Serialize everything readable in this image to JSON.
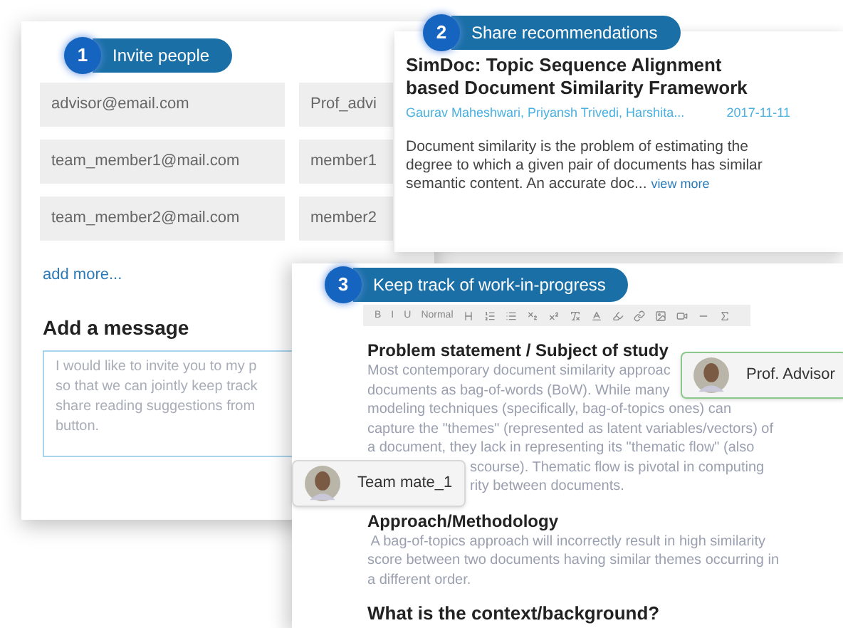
{
  "invite": {
    "step": {
      "number": "1",
      "label": "Invite people"
    },
    "rows": [
      {
        "email": "advisor@email.com",
        "name": "Prof_advi"
      },
      {
        "email": "team_member1@mail.com",
        "name": "member1"
      },
      {
        "email": "team_member2@mail.com",
        "name": "member2"
      }
    ],
    "add_more": "add more...",
    "message_title": "Add a message",
    "message_placeholder": "I would like to invite you to my p\nso that we can jointly keep track\nshare reading suggestions from\nbutton."
  },
  "recommendation": {
    "step": {
      "number": "2",
      "label": "Share recommendations"
    },
    "title": "SimDoc: Topic Sequence Alignment based Document Similarity Framework",
    "authors": "Gaurav Maheshwari, Priyansh Trivedi, Harshita...",
    "date": "2017-11-11",
    "abstract": "Document similarity is the problem of estimating the degree to which a given pair of documents has similar semantic content. An accurate doc...",
    "view_more": "view more"
  },
  "editor": {
    "step": {
      "number": "3",
      "label": "Keep track of work-in-progress"
    },
    "toolbar": [
      {
        "kind": "text",
        "label": "B"
      },
      {
        "kind": "text",
        "label": "I"
      },
      {
        "kind": "text",
        "label": "U"
      },
      {
        "kind": "text",
        "label": "Normal"
      },
      {
        "kind": "icon"
      },
      {
        "kind": "icon"
      },
      {
        "kind": "icon"
      },
      {
        "kind": "icon"
      },
      {
        "kind": "icon"
      },
      {
        "kind": "icon"
      },
      {
        "kind": "icon"
      },
      {
        "kind": "icon"
      },
      {
        "kind": "icon"
      },
      {
        "kind": "icon"
      },
      {
        "kind": "icon"
      },
      {
        "kind": "icon"
      },
      {
        "kind": "icon"
      }
    ],
    "sections": [
      {
        "heading": "Problem statement / Subject of study",
        "lines": [
          {
            "text": "Most contemporary document similarity approac",
            "kind": "line"
          },
          {
            "text": "documents as bag-of-words (BoW). While many",
            "kind": "line"
          },
          {
            "text": "modeling techniques (specifically, bag-of-topics ones) can",
            "kind": "line"
          },
          {
            "text": "capture the \"themes\" (represented as latent variables/vectors) of",
            "kind": "line"
          },
          {
            "text": "a document, they lack in representing its \"thematic flow\" (also",
            "kind": "line"
          },
          {
            "text": "scourse). Thematic flow is pivotal in computing",
            "kind": "beside_card"
          },
          {
            "text": "rity between documents.",
            "kind": "beside_card"
          }
        ]
      },
      {
        "heading": "Approach/Methodology",
        "lines": [
          {
            "text": " A bag-of-topics approach will incorrectly result in high similarity",
            "kind": "line"
          },
          {
            "text": "score between two documents having similar themes occurring in",
            "kind": "line"
          },
          {
            "text": "a different order.",
            "kind": "line"
          }
        ]
      }
    ],
    "next_heading": "What is the context/background?"
  },
  "collaborators": [
    {
      "name": "Prof. Advisor",
      "active": true
    },
    {
      "name": "Team mate_1",
      "active": false
    }
  ]
}
